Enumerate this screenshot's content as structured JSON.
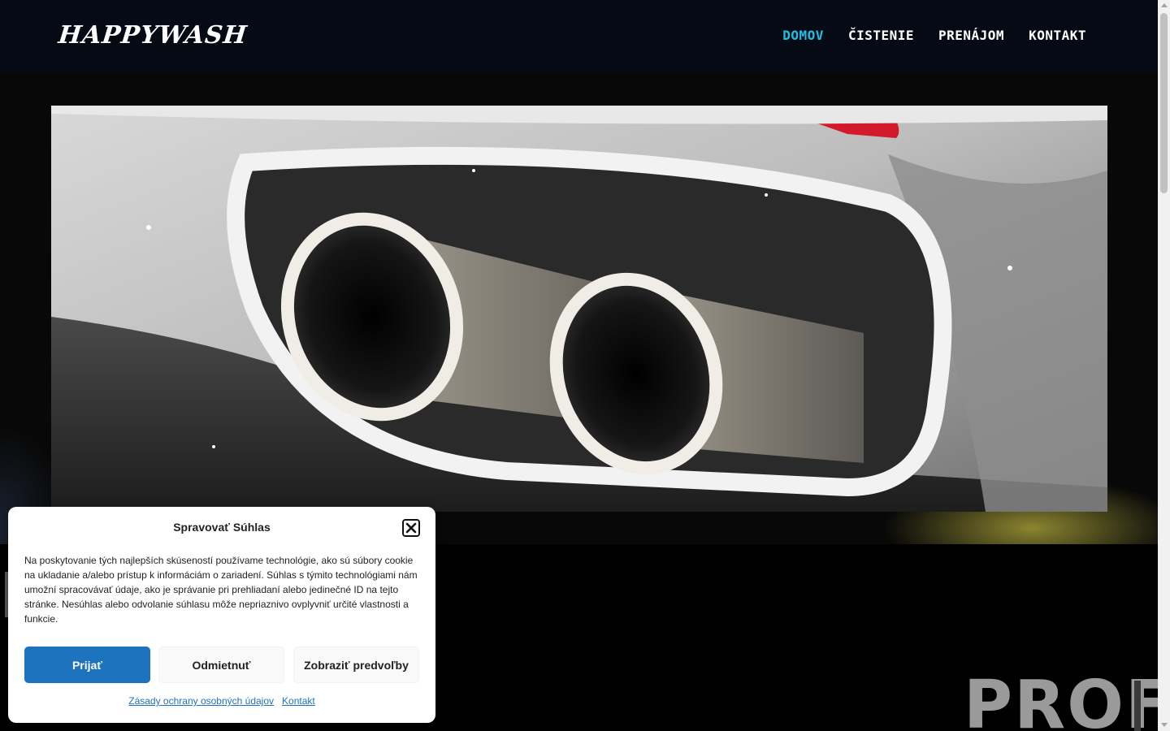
{
  "header": {
    "logo": "HAPPYWASH",
    "nav": [
      {
        "label": "DOMOV",
        "active": true
      },
      {
        "label": "ČISTENIE",
        "active": false
      },
      {
        "label": "PRENÁJOM",
        "active": false
      },
      {
        "label": "KONTAKT",
        "active": false
      }
    ]
  },
  "hero": {
    "image_icon": "car-exhaust-foam-image"
  },
  "section": {
    "heading_partial": "PROF"
  },
  "cookie": {
    "title": "Spravovať Súhlas",
    "text": "Na poskytovanie tých najlepších skúseností používame technológie, ako sú súbory cookie na ukladanie a/alebo prístup k informáciám o zariadení. Súhlas s týmito technológiami nám umožní spracovávať údaje, ako je správanie pri prehliadaní alebo jedinečné ID na tejto stránke. Nesúhlas alebo odvolanie súhlasu môže nepriaznivo ovplyvniť určité vlastnosti a funkcie.",
    "accept": "Prijať",
    "deny": "Odmietnuť",
    "preferences": "Zobraziť predvoľby",
    "privacy_link": "Zásady ochrany osobných údajov",
    "contact_link": "Kontakt"
  },
  "colors": {
    "nav_active": "#1ec0e6",
    "accept_button": "#1e73be",
    "header_bg": "#050a14"
  }
}
